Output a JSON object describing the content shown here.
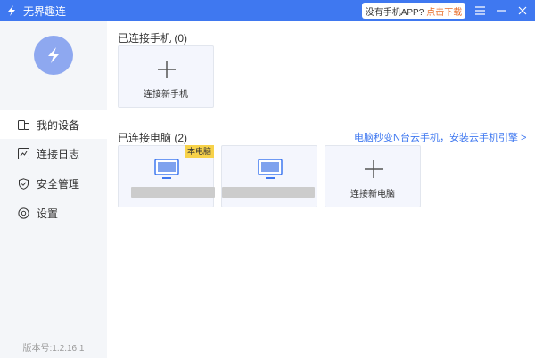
{
  "titlebar": {
    "app_title": "无界趣连",
    "promo_text": "没有手机APP?",
    "promo_link": "点击下载",
    "menu_icon": "menu-icon",
    "minimize_icon": "minimize-icon",
    "close_icon": "close-icon"
  },
  "sidebar": {
    "items": [
      {
        "label": "我的设备",
        "icon": "devices-icon",
        "active": true
      },
      {
        "label": "连接日志",
        "icon": "log-icon",
        "active": false
      },
      {
        "label": "安全管理",
        "icon": "shield-icon",
        "active": false
      },
      {
        "label": "设置",
        "icon": "settings-icon",
        "active": false
      }
    ],
    "version": "版本号:1.2.16.1"
  },
  "phones": {
    "title": "已连接手机 (0)",
    "add_label": "连接新手机"
  },
  "computers": {
    "title": "已连接电脑 (2)",
    "promo_link": "电脑秒变N台云手机，安装云手机引擎 >",
    "devices": [
      {
        "badge": "本电脑"
      },
      {
        "badge": ""
      }
    ],
    "add_label": "连接新电脑"
  },
  "colors": {
    "accent": "#3f78f0",
    "badge": "#f7d24a",
    "promo_orange": "#e86d2a"
  }
}
